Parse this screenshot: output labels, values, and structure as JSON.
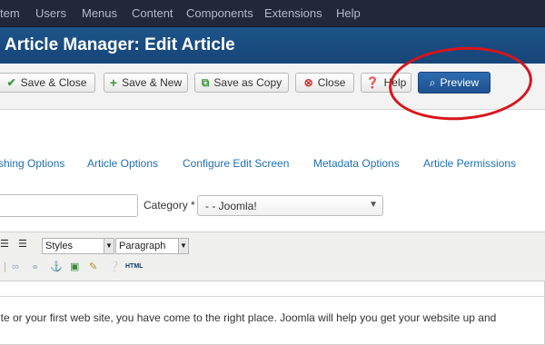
{
  "menu": {
    "items": [
      {
        "label": "tem"
      },
      {
        "label": "Users"
      },
      {
        "label": "Menus"
      },
      {
        "label": "Content"
      },
      {
        "label": "Components"
      },
      {
        "label": "Extensions"
      },
      {
        "label": "Help"
      }
    ]
  },
  "header": {
    "title": "Article Manager: Edit Article"
  },
  "toolbar": {
    "save_close": "Save & Close",
    "save_new": "Save & New",
    "save_copy": "Save as Copy",
    "close": "Close",
    "help": "Help",
    "preview": "Preview"
  },
  "tabs": [
    {
      "label": "shing Options"
    },
    {
      "label": "Article Options"
    },
    {
      "label": "Configure Edit Screen"
    },
    {
      "label": "Metadata Options"
    },
    {
      "label": "Article Permissions"
    }
  ],
  "form": {
    "category_label": "Category *",
    "category_value": "- - Joomla!"
  },
  "editor": {
    "styles_select": "Styles",
    "format_select": "Paragraph",
    "html_button": "HTML",
    "content": "ite or your first web site, you have come to the right place. Joomla will help you get your website up and"
  },
  "colors": {
    "menubar": "#22283a",
    "titlebar": "#1d5488",
    "primary_button": "#1e5190",
    "annotation_circle": "#d9141a",
    "tab_link": "#1f6fb5"
  }
}
